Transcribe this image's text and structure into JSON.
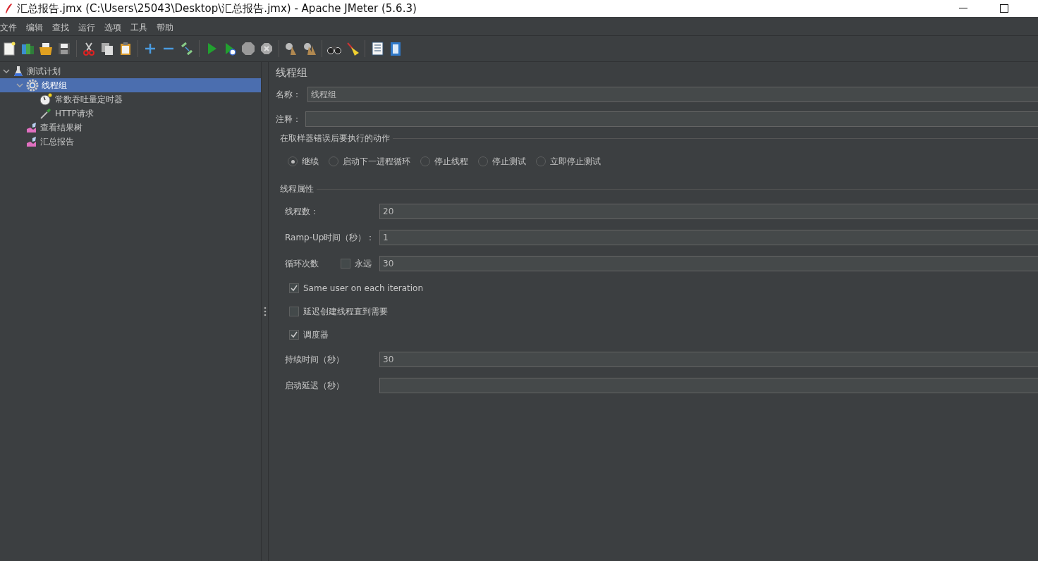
{
  "window": {
    "title": "汇总报告.jmx (C:\\Users\\25043\\Desktop\\汇总报告.jmx) - Apache JMeter (5.6.3)"
  },
  "menu": [
    "文件",
    "编辑",
    "查找",
    "运行",
    "选项",
    "工具",
    "帮助"
  ],
  "tree": [
    {
      "kind": "plan",
      "label": "测试计划",
      "expanded": true,
      "selected": false,
      "children": [
        {
          "kind": "group",
          "label": "线程组",
          "expanded": true,
          "selected": true,
          "children": [
            {
              "kind": "timer",
              "label": "常数吞吐量定时器",
              "selected": false
            },
            {
              "kind": "sampler",
              "label": "HTTP请求",
              "selected": false
            }
          ]
        },
        {
          "kind": "listener",
          "label": "查看结果树",
          "selected": false
        },
        {
          "kind": "listener",
          "label": "汇总报告",
          "selected": false
        }
      ]
    }
  ],
  "panel": {
    "title": "线程组",
    "name_label": "名称：",
    "name_value": "线程组",
    "comment_label": "注释：",
    "error_action": {
      "legend": "在取样器错误后要执行的动作",
      "options": [
        {
          "label": "继续",
          "selected": true
        },
        {
          "label": "启动下一进程循环",
          "selected": false
        },
        {
          "label": "停止线程",
          "selected": false
        },
        {
          "label": "停止测试",
          "selected": false
        },
        {
          "label": "立即停止测试",
          "selected": false
        }
      ]
    },
    "thread_props": {
      "legend": "线程属性",
      "rows": [
        {
          "kind": "field",
          "label": "线程数：",
          "value": "20"
        },
        {
          "kind": "field",
          "label": "Ramp-Up时间（秒）：",
          "value": "1"
        },
        {
          "kind": "loop",
          "label": "循环次数",
          "check_label": "永远",
          "checked": false,
          "value": "30"
        },
        {
          "kind": "check",
          "label": "Same user on each iteration",
          "checked": true
        },
        {
          "kind": "check",
          "label": "延迟创建线程直到需要",
          "checked": false
        },
        {
          "kind": "check",
          "label": "调度器",
          "checked": true
        },
        {
          "kind": "field",
          "label": "持续时间（秒）",
          "value": "30"
        },
        {
          "kind": "field",
          "label": "启动延迟（秒）"
        }
      ]
    }
  }
}
